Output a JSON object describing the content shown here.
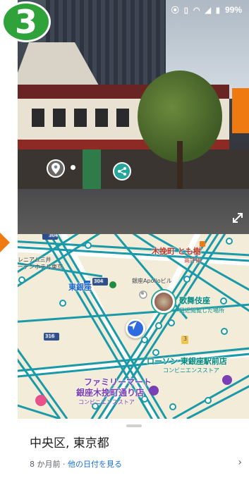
{
  "step_badge": {
    "number": "3",
    "color": "#2fa33a"
  },
  "status_bar": {
    "battery": "99%",
    "icons": [
      "location-icon",
      "vibrate-icon",
      "wifi-icon",
      "signal-icon",
      "battery-icon"
    ]
  },
  "street_view": {
    "controls": [
      "location-pin-icon",
      "share-icon",
      "expand-icon"
    ]
  },
  "map": {
    "labels": {
      "kobikicho_tomoju": "木挽町 とも樹",
      "kobikicho_tomoju_sub": "高評価",
      "hotel": "レニアム三井\nーデンホテル東京",
      "higashi_ginza": "東銀座",
      "apollo": "銀座Apolloビル",
      "kabukiza": "歌舞伎座",
      "kabukiza_sub": "最近閲覧した場所",
      "lawson": "ローソン 東銀座駅前店",
      "lawson_sub": "コンビニエンスストア",
      "familymart_1": "ファミリーマート",
      "familymart_2": "銀座木挽町通り店",
      "familymart_sub": "コンビニエンスストア",
      "route_304": "304",
      "route_316": "316",
      "marker_3": "3"
    },
    "colors": {
      "transit": "#1a9aa8",
      "background": "#f3ecd9"
    }
  },
  "sheet": {
    "title": "中央区, 東京都",
    "date_prefix": "8 か月前 · ",
    "date_link": "他の日付を見る",
    "chevron": "›"
  }
}
